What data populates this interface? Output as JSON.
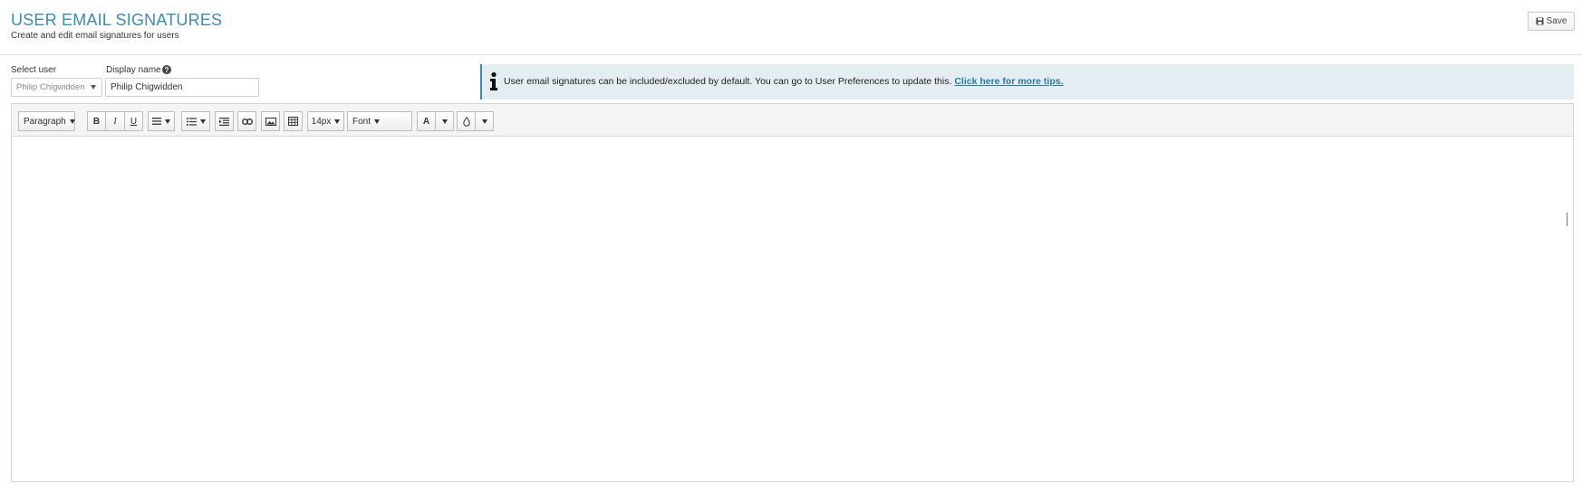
{
  "header": {
    "title": "USER EMAIL SIGNATURES",
    "subtitle": "Create and edit email signatures for users",
    "save_label": "Save"
  },
  "form": {
    "select_user_label": "Select user",
    "select_user_value": "Philip Chigwidden",
    "display_name_label": "Display name",
    "display_name_value": "Philip Chigwidden"
  },
  "banner": {
    "text": "User email signatures can be included/excluded by default. You can go to User Preferences to update this.",
    "link": "Click here for more tips."
  },
  "toolbar": {
    "paragraph_label": "Paragraph",
    "bold_label": "B",
    "italic_label": "I",
    "underline_label": "U",
    "font_size_label": "14px",
    "font_label": "Font",
    "text_color_label": "A"
  },
  "colors": {
    "accent": "#3f8ab1",
    "banner_bg": "#e4eef2",
    "toolbar_bg": "#f4f4f4"
  }
}
